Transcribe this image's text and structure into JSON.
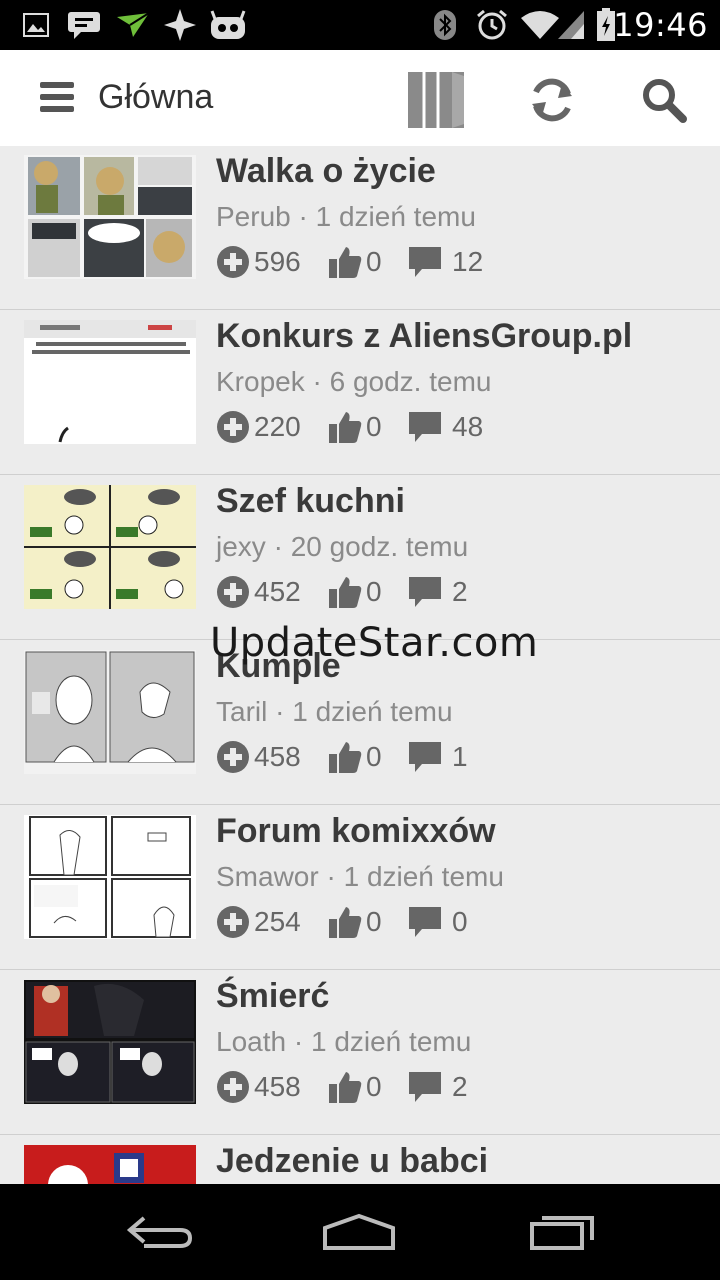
{
  "status_bar": {
    "time": "19:46",
    "icons": [
      "image-icon",
      "chat-icon",
      "plane-icon",
      "sparkle-icon",
      "android-icon",
      "bluetooth-icon",
      "alarm-icon",
      "wifi-icon",
      "signal-icon",
      "battery-icon"
    ]
  },
  "action_bar": {
    "title": "Główna",
    "menu_icon": "hamburger-icon",
    "actions": [
      "pages-icon",
      "refresh-icon",
      "search-icon"
    ]
  },
  "items": [
    {
      "title": "Walka o życie",
      "author": "Perub",
      "time": "1 dzień temu",
      "plus": "596",
      "likes": "0",
      "comments": "12"
    },
    {
      "title": "Konkurs z AliensGroup.pl",
      "author": "Kropek",
      "time": "6 godz. temu",
      "plus": "220",
      "likes": "0",
      "comments": "48"
    },
    {
      "title": "Szef kuchni",
      "author": "jexy",
      "time": "20 godz. temu",
      "plus": "452",
      "likes": "0",
      "comments": "2"
    },
    {
      "title": "Kumple",
      "author": "Taril",
      "time": "1 dzień temu",
      "plus": "458",
      "likes": "0",
      "comments": "1"
    },
    {
      "title": "Forum komixxów",
      "author": "Smawor",
      "time": "1 dzień temu",
      "plus": "254",
      "likes": "0",
      "comments": "0"
    },
    {
      "title": "Śmierć",
      "author": "Loath",
      "time": "1 dzień temu",
      "plus": "458",
      "likes": "0",
      "comments": "2"
    },
    {
      "title": "Jedzenie u babci",
      "author": "",
      "time": "",
      "plus": "",
      "likes": "",
      "comments": ""
    }
  ],
  "watermark": "UpdateStar.com",
  "nav_bar": [
    "back-icon",
    "home-icon",
    "recents-icon"
  ],
  "colors": {
    "background": "#ececec",
    "action_bar": "#ffffff",
    "title": "#3a3a3a",
    "meta": "#8a8a8a",
    "icon_gray": "#666666"
  }
}
